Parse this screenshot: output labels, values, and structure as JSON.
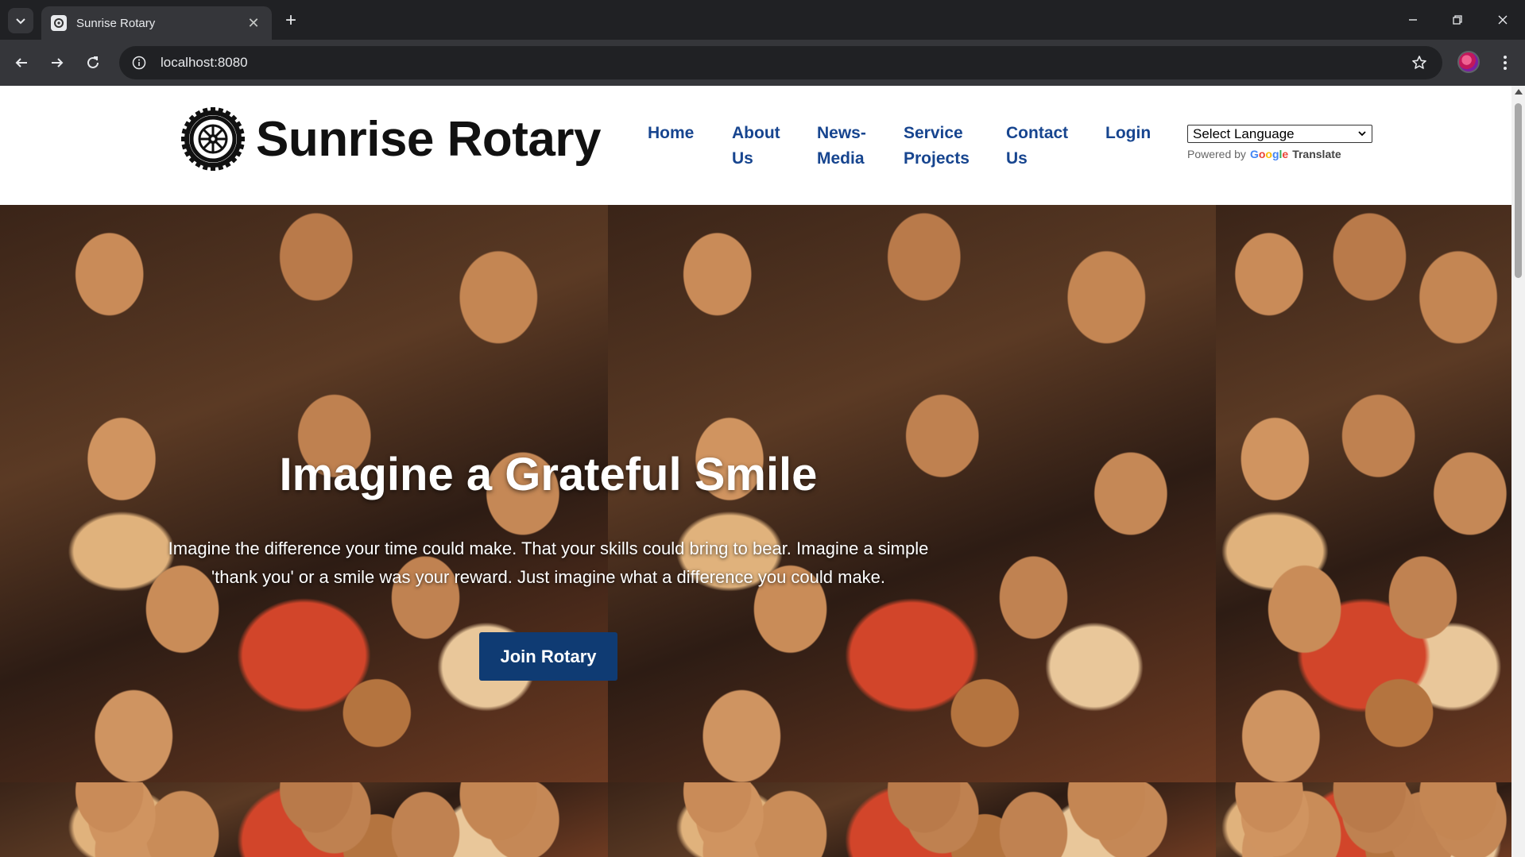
{
  "browser": {
    "tab": {
      "title": "Sunrise Rotary",
      "favicon": "rotary-favicon"
    },
    "url": "localhost:8080",
    "icons": {
      "tab_search": "chevron-down-icon",
      "new_tab": "plus-icon",
      "back": "arrow-left-icon",
      "forward": "arrow-right-icon",
      "reload": "reload-icon",
      "site_info": "info-icon",
      "bookmark": "star-icon",
      "menu": "kebab-menu-icon"
    }
  },
  "site": {
    "logo_text": "Sunrise Rotary",
    "nav": [
      {
        "lines": [
          "Home"
        ]
      },
      {
        "lines": [
          "About",
          "Us"
        ]
      },
      {
        "lines": [
          "News-",
          "Media"
        ]
      },
      {
        "lines": [
          "Service",
          "Projects"
        ]
      },
      {
        "lines": [
          "Contact",
          "Us"
        ]
      },
      {
        "lines": [
          "Login"
        ]
      }
    ],
    "language": {
      "selected": "Select Language",
      "powered_by": "Powered by",
      "google": "Google",
      "translate": "Translate"
    }
  },
  "hero": {
    "title": "Imagine a Grateful Smile",
    "subtitle": "Imagine the difference your time could make. That your skills could bring to bear. Imagine a simple 'thank you' or a smile was your reward. Just imagine what a difference you could make.",
    "button": "Join Rotary"
  },
  "colors": {
    "nav": "#17458f",
    "button": "#0f3b73",
    "chrome_dark": "#202124",
    "chrome_toolbar": "#35363a"
  }
}
